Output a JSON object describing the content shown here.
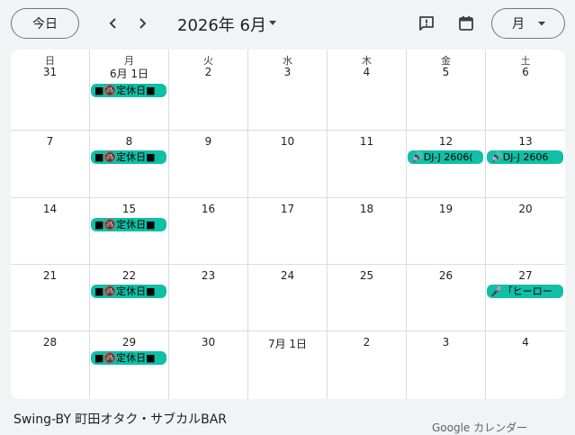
{
  "toolbar": {
    "today_label": "今日",
    "month_title": "2026年 6月",
    "view_label": "月"
  },
  "weekdays": [
    "日",
    "月",
    "火",
    "水",
    "木",
    "金",
    "土"
  ],
  "weeks": [
    {
      "days": [
        {
          "num": "31",
          "weekday": "日"
        },
        {
          "num": "6月 1日",
          "weekday": "月",
          "event": "■🚳定休日■"
        },
        {
          "num": "2",
          "weekday": "火"
        },
        {
          "num": "3",
          "weekday": "水"
        },
        {
          "num": "4",
          "weekday": "木"
        },
        {
          "num": "5",
          "weekday": "金"
        },
        {
          "num": "6",
          "weekday": "土"
        }
      ]
    },
    {
      "days": [
        {
          "num": "7"
        },
        {
          "num": "8",
          "event": "■🚳定休日■"
        },
        {
          "num": "9"
        },
        {
          "num": "10"
        },
        {
          "num": "11"
        },
        {
          "num": "12",
          "event": "🔊DJ-J 2606("
        },
        {
          "num": "13",
          "event": "🔊DJ-J 2606"
        }
      ]
    },
    {
      "days": [
        {
          "num": "14"
        },
        {
          "num": "15",
          "event": "■🚳定休日■"
        },
        {
          "num": "16"
        },
        {
          "num": "17"
        },
        {
          "num": "18"
        },
        {
          "num": "19"
        },
        {
          "num": "20"
        }
      ]
    },
    {
      "days": [
        {
          "num": "21"
        },
        {
          "num": "22",
          "event": "■🚳定休日■"
        },
        {
          "num": "23"
        },
        {
          "num": "24"
        },
        {
          "num": "25"
        },
        {
          "num": "26"
        },
        {
          "num": "27",
          "event": "🎤「ヒーロー"
        }
      ]
    },
    {
      "days": [
        {
          "num": "28"
        },
        {
          "num": "29",
          "event": "■🚳定休日■"
        },
        {
          "num": "30"
        },
        {
          "num": "7月 1日"
        },
        {
          "num": "2"
        },
        {
          "num": "3"
        },
        {
          "num": "4"
        }
      ]
    }
  ],
  "footer": {
    "calendar_name": "Swing-BY 町田オタク・サブカルBAR",
    "brand": "Google カレンダー"
  },
  "colors": {
    "event_bg": "#0fbfa6",
    "page_bg": "#f1f3f4",
    "grid_line": "#dadce0"
  },
  "icons": [
    "chevron-left-icon",
    "chevron-right-icon",
    "dropdown-arrow-icon",
    "feedback-icon",
    "calendar-icon"
  ]
}
